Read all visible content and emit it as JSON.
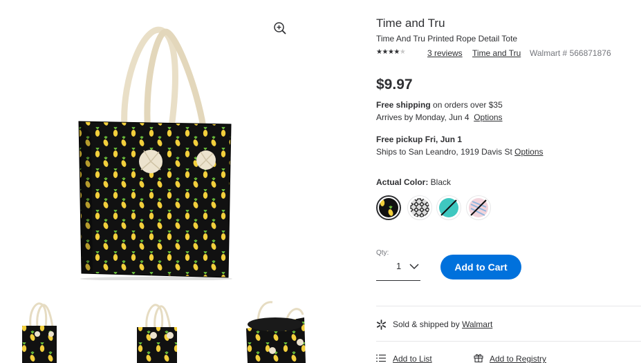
{
  "product": {
    "brand": "Time and Tru",
    "name": "Time And Tru Printed Rope Detail Tote",
    "rating": 4,
    "rating_max": 5,
    "reviews_link": "3 reviews",
    "brand_link": "Time and Tru",
    "sku": "Walmart # 566871876",
    "price": "$9.97"
  },
  "shipping": {
    "free_label": "Free shipping",
    "free_suffix": " on orders over $35",
    "arrives": "Arrives by Monday, Jun 4",
    "options_link": "Options"
  },
  "pickup": {
    "title": "Free pickup Fri, Jun 1",
    "ships_to": "Ships to San Leandro, 1919 Davis St",
    "options_link": "Options"
  },
  "color": {
    "label": "Actual Color:",
    "value": " Black",
    "swatches": [
      {
        "name": "Black pineapple",
        "selected": true,
        "available": true
      },
      {
        "name": "Black white geometric",
        "selected": false,
        "available": true
      },
      {
        "name": "Teal",
        "selected": false,
        "available": false
      },
      {
        "name": "Pink blue",
        "selected": false,
        "available": false
      }
    ]
  },
  "quantity": {
    "label": "Qty:",
    "value": "1"
  },
  "cart": {
    "add_label": "Add to Cart"
  },
  "seller": {
    "prefix": "Sold & shipped by ",
    "name": "Walmart"
  },
  "actions": {
    "add_to_list": "Add to List",
    "add_to_registry": "Add to Registry"
  },
  "colors": {
    "accent": "#0071dc",
    "text": "#2e2f32",
    "muted": "#74767c",
    "divider": "#e6e7e8"
  },
  "icons": [
    "zoom-in-icon",
    "star-icon",
    "chevron-down-icon",
    "walmart-spark-icon",
    "list-icon",
    "gift-icon"
  ]
}
